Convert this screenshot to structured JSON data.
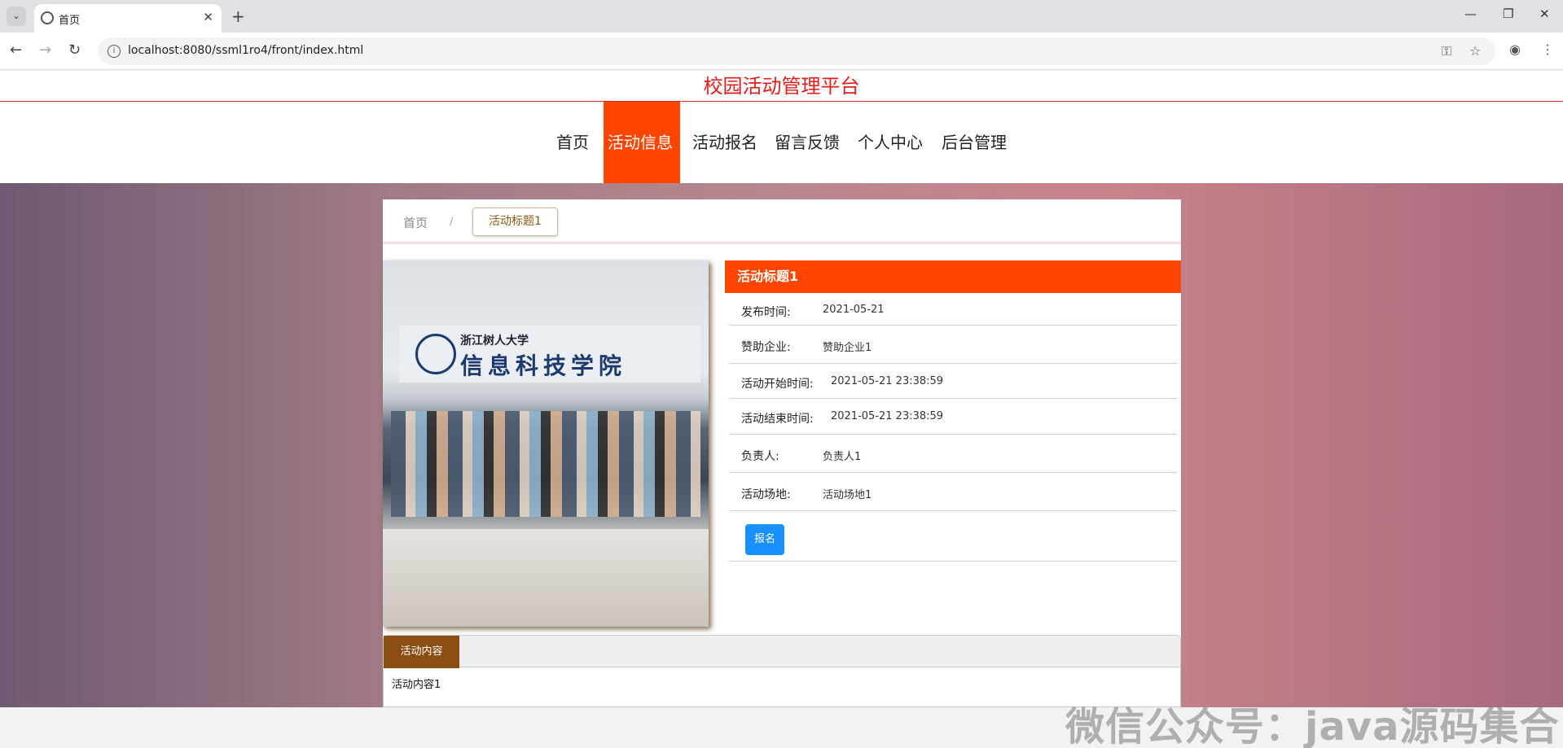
{
  "browser": {
    "tab_title": "首页",
    "url": "localhost:8080/ssml1ro4/front/index.html"
  },
  "site": {
    "title": "校园活动管理平台",
    "nav": [
      "首页",
      "活动信息",
      "活动报名",
      "留言反馈",
      "个人中心",
      "后台管理"
    ],
    "active_nav": "活动信息"
  },
  "breadcrumb": {
    "home": "首页",
    "separator": "/",
    "current": "活动标题1"
  },
  "photo": {
    "banner_line1": "浙江树人大学",
    "banner_line2": "信息科技学院"
  },
  "detail": {
    "title": "活动标题1",
    "rows": [
      {
        "label": "发布时间:",
        "value": "2021-05-21"
      },
      {
        "label": "赞助企业:",
        "value": "赞助企业1"
      },
      {
        "label": "活动开始时间:",
        "value": "2021-05-21 23:38:59"
      },
      {
        "label": "活动结束时间:",
        "value": "2021-05-21 23:38:59"
      },
      {
        "label": "负责人:",
        "value": "负责人1"
      },
      {
        "label": "活动场地:",
        "value": "活动场地1"
      }
    ],
    "signup_label": "报名"
  },
  "content": {
    "tab_label": "活动内容",
    "body": "活动内容1"
  },
  "watermark": "微信公众号：java源码集合",
  "colors": {
    "accent": "#ff4500",
    "title_red": "#e31b1b",
    "tab_brown": "#8b4d12",
    "button_blue": "#1890ff"
  }
}
